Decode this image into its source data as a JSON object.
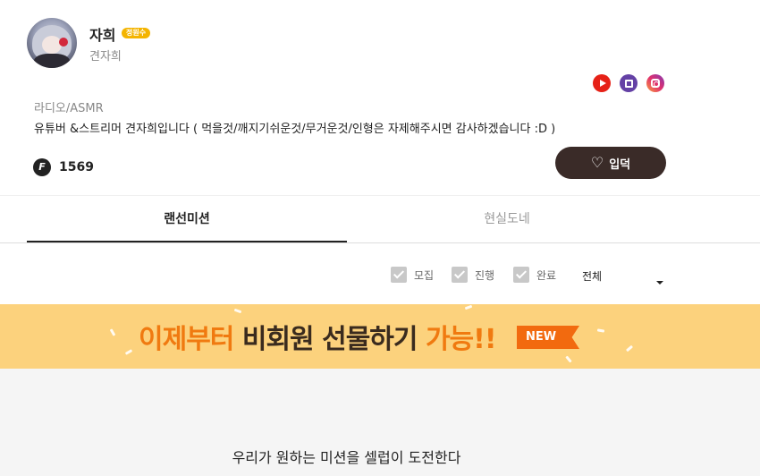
{
  "profile": {
    "name": "자희",
    "badge": "정원수",
    "subname": "견자희",
    "category": "라디오/ASMR",
    "description": "유튜버 &스트리머 견자희입니다 ( 먹을것/깨지기쉬운것/무거운것/인형은 자제해주시면 감사하겠습니다 :D )",
    "fan_icon_letter": "F",
    "fan_count": "1569",
    "follow_label": "입덕",
    "social_icons": [
      "youtube-icon",
      "twitch-icon",
      "instagram-icon"
    ]
  },
  "tabs": [
    {
      "label": "랜선미션",
      "active": true
    },
    {
      "label": "현실도네",
      "active": false
    }
  ],
  "filters": {
    "checkboxes": [
      {
        "label": "모집",
        "checked": true
      },
      {
        "label": "진행",
        "checked": true
      },
      {
        "label": "완료",
        "checked": true
      }
    ],
    "select_value": "전체"
  },
  "banner": {
    "text_part1": "이제부터 ",
    "text_part2": "비회원 선물하기 ",
    "text_part3": "가능!!",
    "tag": "NEW"
  },
  "tagline": "우리가 원하는 미션을 셀럽이 도전한다",
  "colors": {
    "brand_dark": "#3a2b28",
    "banner_bg": "#fcd27d",
    "accent_orange": "#f07a10",
    "badge": "#f4b400"
  }
}
